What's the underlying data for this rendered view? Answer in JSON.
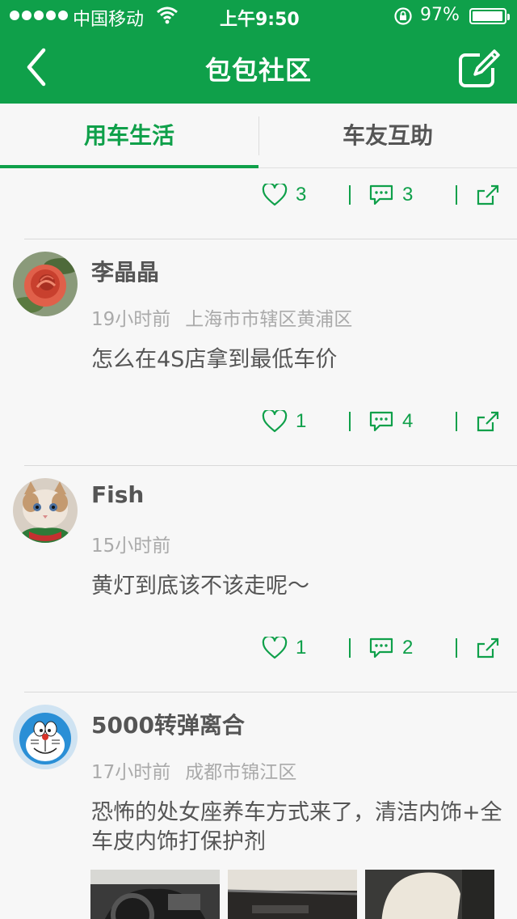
{
  "status_bar": {
    "carrier": "中国移动",
    "time": "上午9:50",
    "battery": "97%",
    "battery_level": 0.97
  },
  "nav": {
    "title": "包包社区",
    "back_icon": "chevron-left-icon",
    "compose_icon": "compose-icon"
  },
  "tabs": [
    {
      "label": "用车生活",
      "active": true
    },
    {
      "label": "车友互助",
      "active": false
    }
  ],
  "colors": {
    "brand": "#0fa04a",
    "text": "#555555",
    "meta": "#aaaaaa"
  },
  "posts": [
    {
      "likes": "3",
      "comments": "3"
    },
    {
      "name": "李晶晶",
      "time": "19小时前",
      "location": "上海市市辖区黄浦区",
      "content": "怎么在4S店拿到最低车价",
      "likes": "1",
      "comments": "4"
    },
    {
      "name": "Fish",
      "time": "15小时前",
      "location": "",
      "content": "黄灯到底该不该走呢～",
      "likes": "1",
      "comments": "2"
    },
    {
      "name": "5000转弹离合",
      "time": "17小时前",
      "location": "成都市锦江区",
      "content": "恐怖的处女座养车方式来了，清洁内饰+全车皮内饰打保护剂"
    }
  ]
}
